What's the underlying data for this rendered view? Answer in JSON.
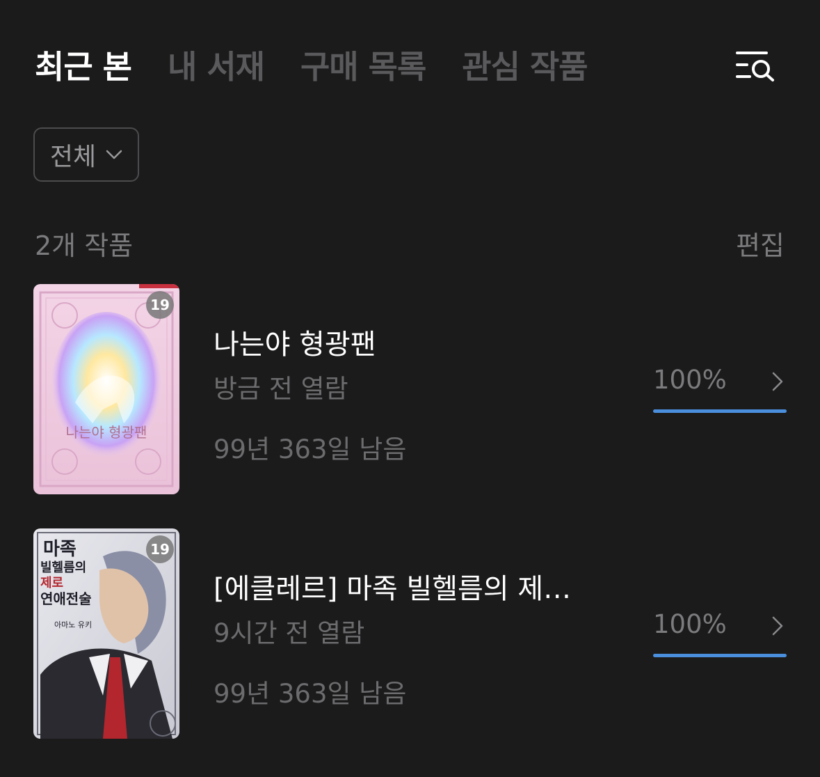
{
  "tabs": [
    {
      "label": "최근 본",
      "active": true
    },
    {
      "label": "내 서재",
      "active": false
    },
    {
      "label": "구매 목록",
      "active": false
    },
    {
      "label": "관심 작품",
      "active": false
    }
  ],
  "header": {
    "search_icon": "search-list-icon"
  },
  "filter": {
    "selected": "전체",
    "icon": "chevron-down-icon"
  },
  "list_header": {
    "count": "2개 작품",
    "edit_label": "편집"
  },
  "colors": {
    "background": "#1b1b1c",
    "progress": "#4a8fde",
    "muted": "#6c6c6e"
  },
  "items": [
    {
      "badge": "19",
      "cover_text": "나는야 형광팬",
      "title": "나는야 형광팬",
      "opened": "방금 전 열람",
      "remaining": "99년 363일 남음",
      "progress_label": "100%",
      "progress": 1.0
    },
    {
      "badge": "19",
      "cover_text": "마족 빌헬름의 제로부터 시작하는 연애전술",
      "cover_author": "아마노 유키",
      "title": "[에클레르] 마족 빌헬름의 제…",
      "opened": "9시간 전 열람",
      "remaining": "99년 363일 남음",
      "progress_label": "100%",
      "progress": 1.0
    }
  ]
}
